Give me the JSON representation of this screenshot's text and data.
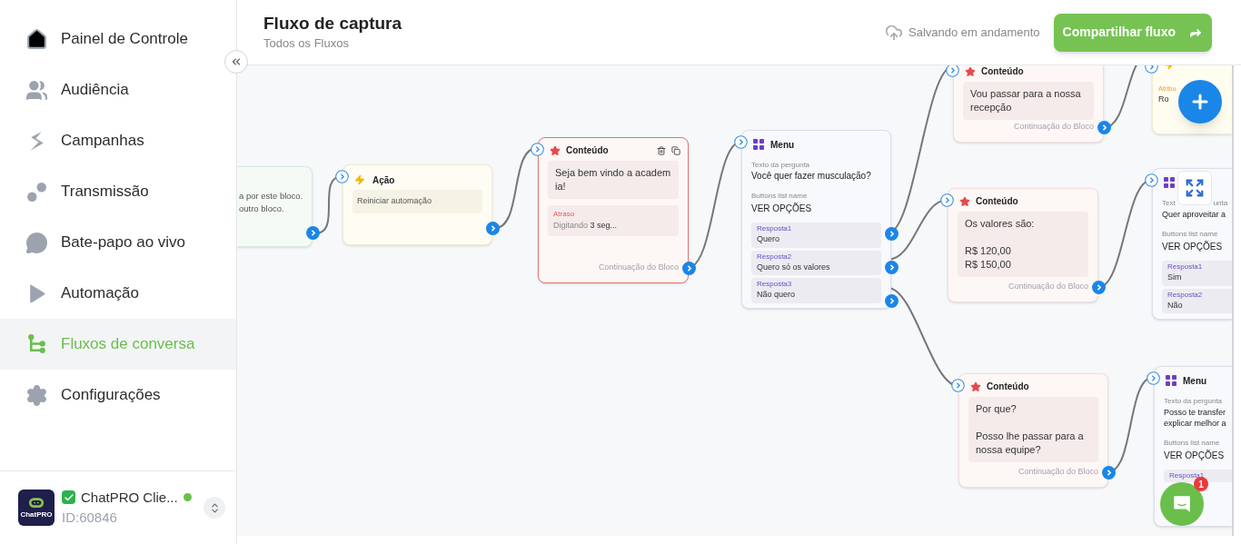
{
  "sidebar": {
    "items": [
      {
        "label": "Painel de Controle",
        "selected": false
      },
      {
        "label": "Audiência",
        "selected": false
      },
      {
        "label": "Campanhas",
        "selected": false
      },
      {
        "label": "Transmissão",
        "selected": false
      },
      {
        "label": "Bate-papo ao vivo",
        "selected": false
      },
      {
        "label": "Automação",
        "selected": false
      },
      {
        "label": "Fluxos de conversa",
        "selected": true
      },
      {
        "label": "Configurações",
        "selected": false
      }
    ],
    "account": {
      "logo_text": "ChatPRO",
      "name": "ChatPRO Clie...",
      "verified": true,
      "online": true,
      "id": "ID:60846"
    }
  },
  "header": {
    "title": "Fluxo de captura",
    "subtitle": "Todos os Fluxos",
    "save_status": "Salvando em andamento",
    "share_button": "Compartilhar fluxo"
  },
  "canvas": {
    "nodes": [
      {
        "kind": "note",
        "selected": false,
        "lines": [
          "a por este bloco.",
          "outro bloco."
        ]
      },
      {
        "kind": "action",
        "selected": false,
        "title": "Ação",
        "action": "Reiniciar automação"
      },
      {
        "kind": "content",
        "selected": true,
        "title": "Conteúdo",
        "message": "Seja bem vindo a academia!",
        "delay": {
          "label": "Atraso",
          "mode": "Digitando",
          "value": "3 seg..."
        },
        "footer": "Continuação do Bloco"
      },
      {
        "kind": "menu",
        "selected": false,
        "title": "Menu",
        "question_label": "Texto da pergunta",
        "question": "Você quer fazer musculação?",
        "list_label": "Buttons list name",
        "list_name": "VER OPÇÕES",
        "responses": [
          {
            "label": "Resposta1",
            "value": "Quero"
          },
          {
            "label": "Resposta2",
            "value": "Quero só os valores"
          },
          {
            "label": "Resposta3",
            "value": "Não quero"
          }
        ]
      },
      {
        "kind": "content",
        "selected": false,
        "title": "Conteúdo",
        "message": "Vou passar para a nossa recepção",
        "footer": "Continuação do Bloco"
      },
      {
        "kind": "assign",
        "selected": false,
        "label": "Atribu",
        "value": "Ro"
      },
      {
        "kind": "content",
        "selected": false,
        "title": "Conteúdo",
        "message": "Os valores são:\n\nR$ 120,00\nR$ 150,00",
        "footer": "Continuação do Bloco"
      },
      {
        "kind": "menu",
        "selected": false,
        "question_label": [
          "Text",
          "unta"
        ],
        "question": "Quer aproveitar a",
        "list_label": "Buttons list name",
        "list_name": "VER OPÇÕES",
        "responses": [
          {
            "label": "Resposta1",
            "value": "Sim"
          },
          {
            "label": "Resposta2",
            "value": "Não"
          }
        ]
      },
      {
        "kind": "content",
        "selected": false,
        "title": "Conteúdo",
        "message": "Por que?\n\nPosso lhe passar para a nossa equipe?",
        "footer": "Continuação do Bloco"
      },
      {
        "kind": "menu",
        "selected": false,
        "title": "Menu",
        "question_label": "Texto da pergunta",
        "question": "Posso te transfer\nexplicar melhor a",
        "list_label": "Buttons list name",
        "list_name": "VER OPÇÕES",
        "responses": [
          {
            "label": "Resposta1"
          }
        ]
      }
    ]
  },
  "chat_widget": {
    "badge": "1"
  }
}
